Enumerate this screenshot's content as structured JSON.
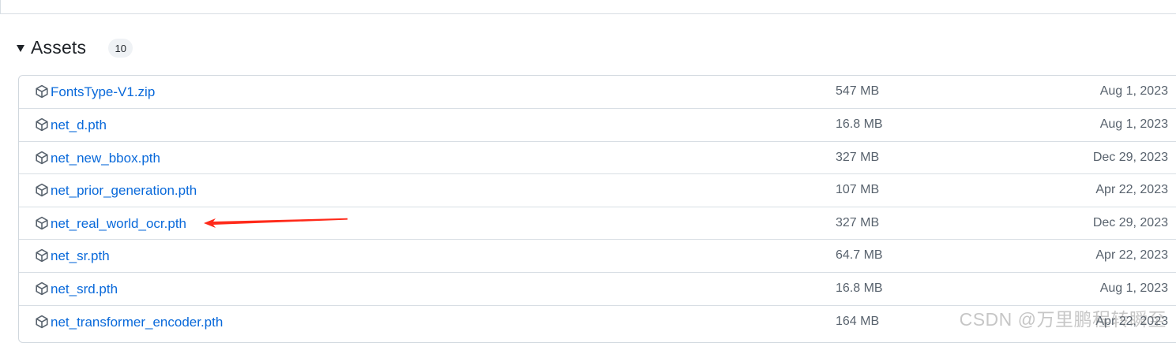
{
  "assets": {
    "title": "Assets",
    "count": "10",
    "items": [
      {
        "name": "FontsType-V1.zip",
        "size": "547 MB",
        "date": "Aug 1, 2023"
      },
      {
        "name": "net_d.pth",
        "size": "16.8 MB",
        "date": "Aug 1, 2023"
      },
      {
        "name": "net_new_bbox.pth",
        "size": "327 MB",
        "date": "Dec 29, 2023"
      },
      {
        "name": "net_prior_generation.pth",
        "size": "107 MB",
        "date": "Apr 22, 2023"
      },
      {
        "name": "net_real_world_ocr.pth",
        "size": "327 MB",
        "date": "Dec 29, 2023"
      },
      {
        "name": "net_sr.pth",
        "size": "64.7 MB",
        "date": "Apr 22, 2023"
      },
      {
        "name": "net_srd.pth",
        "size": "16.8 MB",
        "date": "Aug 1, 2023"
      },
      {
        "name": "net_transformer_encoder.pth",
        "size": "164 MB",
        "date": "Apr 22, 2023"
      }
    ]
  },
  "annotation": {
    "arrow_color": "#ff2a1a"
  },
  "watermark": "CSDN @万里鹏程转瞬至",
  "colors": {
    "link": "#0969da",
    "muted_text": "#59636e",
    "border": "#d0d7de"
  },
  "icons": {
    "asset": "package-icon",
    "disclosure": "triangle-down-icon"
  }
}
